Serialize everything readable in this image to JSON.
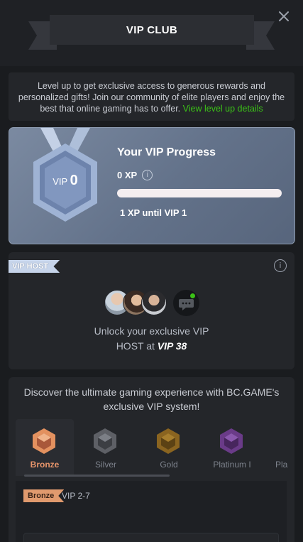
{
  "header": {
    "title": "VIP CLUB"
  },
  "intro": {
    "text": "Level up to get exclusive access to generous rewards and personalized gifts! Join our community of elite players and enjoy the best that online gaming has to offer.",
    "link_label": "View level up details"
  },
  "progress": {
    "medal_prefix": "VIP",
    "medal_level": "0",
    "title": "Your VIP Progress",
    "xp": "0 XP",
    "info_icon": "i",
    "progress_fraction": 0.0,
    "until_text": "1 XP until VIP 1"
  },
  "host": {
    "tag": "VIP HOST",
    "info_icon": "i",
    "text_line1": "Unlock your exclusive VIP",
    "text_line2_prefix": "HOST at ",
    "text_line2_level": "VIP 38"
  },
  "discover": {
    "text": "Discover the ultimate gaming experience with BC.GAME's exclusive VIP system!",
    "tiers": [
      {
        "label": "Bronze",
        "color": "#e3915f",
        "active": true
      },
      {
        "label": "Silver",
        "color": "#8a8d93",
        "active": false
      },
      {
        "label": "Gold",
        "color": "#b8872c",
        "active": false
      },
      {
        "label": "Platinum I",
        "color": "#8a4fb0",
        "active": false
      },
      {
        "label": "Pla",
        "color": "#8a4fb0",
        "active": false
      }
    ],
    "selected_tier_tag": "Bronze",
    "selected_tier_range": "VIP 2-7"
  },
  "colors": {
    "accent_green": "#3bc117",
    "bronze": "#e09a6e",
    "card_bg": "#24262a"
  }
}
